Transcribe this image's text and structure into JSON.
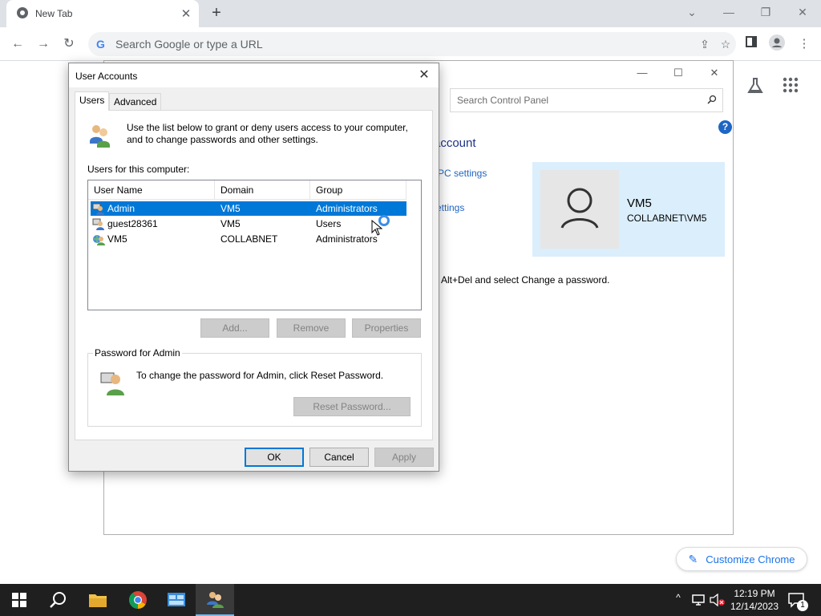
{
  "browser": {
    "tab_title": "New Tab",
    "new_tab_symbol": "+",
    "omnibox_placeholder": "Search Google or type a URL",
    "customize_label": "Customize Chrome"
  },
  "control_panel": {
    "search_placeholder": "Search Control Panel",
    "heading_partial": "account",
    "link_pc_settings": "PC settings",
    "link_settings": "ettings",
    "alt_del_text": "Alt+Del and select Change a password.",
    "user_name": "VM5",
    "user_domain": "COLLABNET\\VM5"
  },
  "dialog": {
    "title": "User Accounts",
    "tabs": [
      {
        "label": "Users",
        "active": true
      },
      {
        "label": "Advanced",
        "active": false
      }
    ],
    "intro_line1": "Use the list below to grant or deny users access to your computer,",
    "intro_line2": "and to change passwords and other settings.",
    "users_label": "Users for this computer:",
    "columns": [
      "User Name",
      "Domain",
      "Group"
    ],
    "rows": [
      {
        "user": "Admin",
        "domain": "VM5",
        "group": "Administrators",
        "selected": true
      },
      {
        "user": "guest28361",
        "domain": "VM5",
        "group": "Users",
        "selected": false
      },
      {
        "user": "VM5",
        "domain": "COLLABNET",
        "group": "Administrators",
        "selected": false
      }
    ],
    "add_label": "Add...",
    "remove_label": "Remove",
    "properties_label": "Properties",
    "password_group_label": "Password for Admin",
    "password_text": "To change the password for Admin, click Reset Password.",
    "reset_label": "Reset Password...",
    "ok_label": "OK",
    "cancel_label": "Cancel",
    "apply_label": "Apply"
  },
  "taskbar": {
    "time": "12:19 PM",
    "date": "12/14/2023",
    "notification_count": "1"
  },
  "colors": {
    "selection": "#0078d7",
    "link": "#1e66c5",
    "chrome_accent": "#1a73e8",
    "taskbar": "#1f1f1f"
  }
}
